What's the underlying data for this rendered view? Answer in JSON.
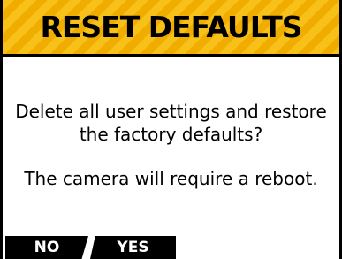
{
  "dialog": {
    "title": "RESET DEFAULTS",
    "message_line1": "Delete all user settings and restore",
    "message_line2": "the factory defaults?",
    "message_note": "The camera will require a reboot.",
    "header_color": "#f7c11a",
    "header_stripe_color": "#f0ad00"
  },
  "softkeys": {
    "no_label": "NO",
    "yes_label": "YES"
  }
}
